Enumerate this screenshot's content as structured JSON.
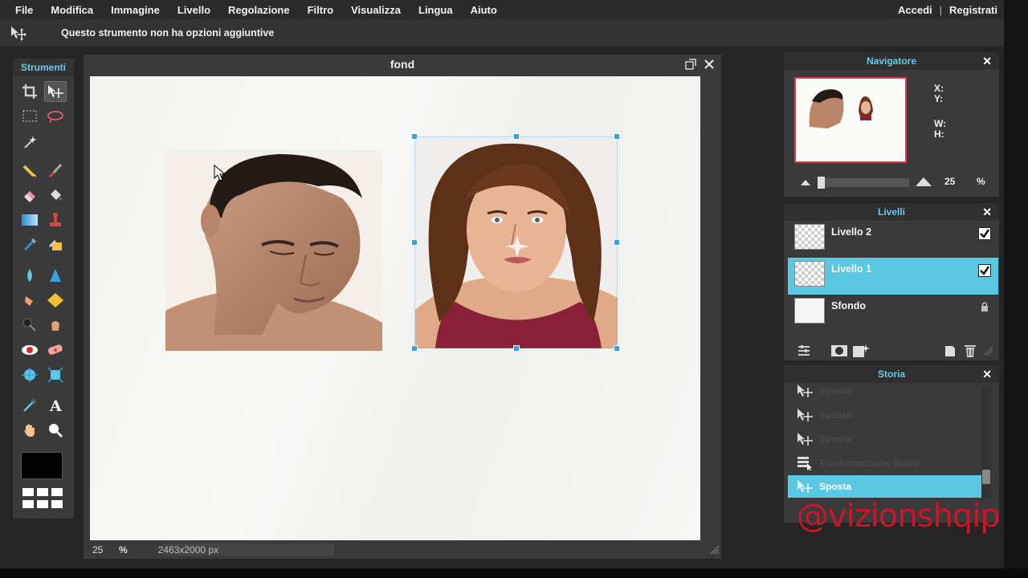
{
  "menubar": {
    "items": [
      "File",
      "Modifica",
      "Immagine",
      "Livello",
      "Regolazione",
      "Filtro",
      "Visualizza",
      "Lingua",
      "Aiuto"
    ],
    "login": "Accedi",
    "separator": "|",
    "register": "Registrati"
  },
  "options_bar": {
    "tool_icon": "move-tool-icon",
    "message": "Questo strumento non ha opzioni aggiuntive"
  },
  "tools_panel": {
    "title": "Strumenti",
    "tools": [
      "crop",
      "move",
      "marquee",
      "lasso",
      "wand",
      "pencil",
      "brush",
      "eraser",
      "bucket",
      "gradient",
      "stamp",
      "color-replace",
      "drawing",
      "blur",
      "sharpen",
      "smudge",
      "sponge",
      "dodge",
      "burn",
      "red-eye",
      "spot-heal",
      "bloat",
      "pinch",
      "color-picker",
      "type",
      "hand",
      "zoom"
    ],
    "active_tool": "move",
    "foreground_color": "#000000"
  },
  "document": {
    "title": "fond",
    "zoom": "25",
    "zoom_unit": "%",
    "dimensions": "2463x2000 px"
  },
  "navigator": {
    "title": "Navigatore",
    "x_label": "X:",
    "y_label": "Y:",
    "w_label": "W:",
    "h_label": "H:",
    "zoom": "25",
    "zoom_unit": "%"
  },
  "layers": {
    "title": "Livelli",
    "items": [
      {
        "name": "Livello 2",
        "visible": true,
        "selected": false
      },
      {
        "name": "Livello 1",
        "visible": true,
        "selected": true
      },
      {
        "name": "Sfondo",
        "locked": true,
        "selected": false
      }
    ]
  },
  "history": {
    "title": "Storia",
    "items": [
      {
        "name": "Sposta",
        "selected": false
      },
      {
        "name": "Sposta",
        "selected": false
      },
      {
        "name": "Sposta",
        "selected": false
      },
      {
        "name": "Trasformazione libera",
        "selected": false
      },
      {
        "name": "Sposta",
        "selected": true
      }
    ]
  },
  "watermark": "@vizionshqip",
  "colors": {
    "accent": "#5ac8e2",
    "panel_title": "#6cc7e6",
    "handle": "#3aa0e0",
    "nav_frame": "#e03a4f"
  }
}
